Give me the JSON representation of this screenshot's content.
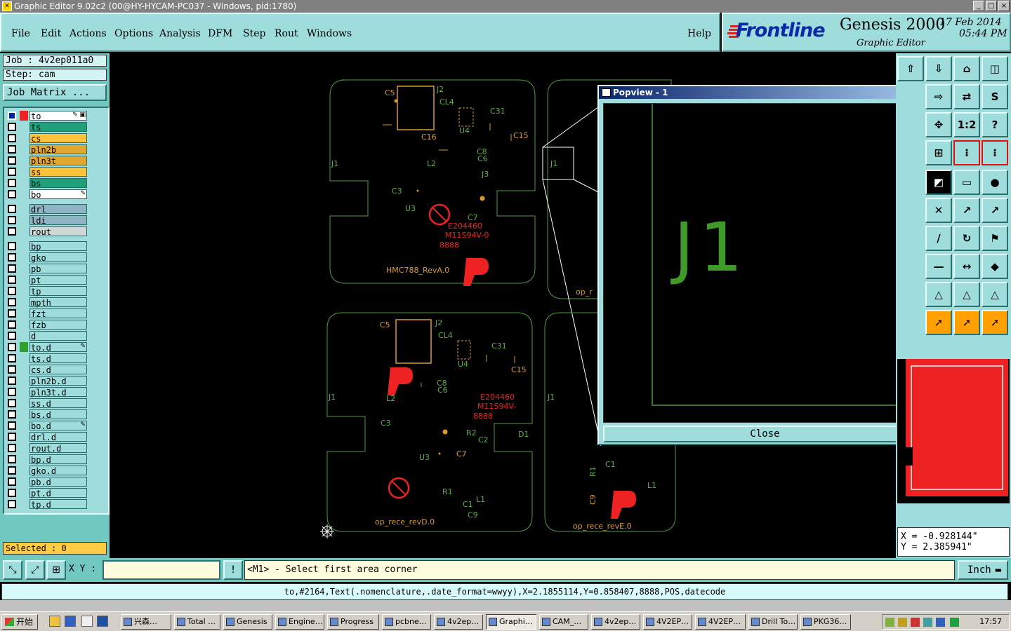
{
  "window": {
    "title": "Graphic Editor 9.02c2 (00@HY-HYCAM-PC037 - Windows, pid:1780)",
    "buttons": [
      "_",
      "□",
      "×"
    ]
  },
  "menu": {
    "items": [
      "File",
      "Edit",
      "Actions",
      "Options",
      "Analysis",
      "DFM",
      "Step",
      "Rout",
      "Windows"
    ],
    "help": "Help"
  },
  "brand": {
    "logo": "Frontline",
    "product": "Genesis 2000",
    "subtitle": "Graphic Editor",
    "date": "17 Feb 2014",
    "time": "05:44 PM"
  },
  "job": {
    "job_line": "Job : 4v2ep011a0",
    "step_line": "Step: cam",
    "matrix_button": "Job Matrix ..."
  },
  "layers": [
    {
      "name": "to",
      "color": "#ffffff",
      "swatch": "#ee2222",
      "flag": "✎ ▣",
      "state": "affected"
    },
    {
      "name": "ts",
      "color": "#1fa07a"
    },
    {
      "name": "cs",
      "color": "#ffc23a"
    },
    {
      "name": "pln2b",
      "color": "#e0a830"
    },
    {
      "name": "pln3t",
      "color": "#e0a830"
    },
    {
      "name": "ss",
      "color": "#ffc23a"
    },
    {
      "name": "bs",
      "color": "#1fa07a"
    },
    {
      "name": "bo",
      "color": "#ffffff",
      "flag": "✎"
    },
    {
      "name": "drl",
      "color": "#8fb4c4"
    },
    {
      "name": "ldi",
      "color": "#8fb4c4"
    },
    {
      "name": "rout",
      "color": "#d0d8d8"
    },
    {
      "name": "bp",
      "color": "#9fdcdc"
    },
    {
      "name": "gko",
      "color": "#9fdcdc"
    },
    {
      "name": "pb",
      "color": "#9fdcdc"
    },
    {
      "name": "pt",
      "color": "#9fdcdc"
    },
    {
      "name": "tp",
      "color": "#9fdcdc"
    },
    {
      "name": "mpth",
      "color": "#9fdcdc"
    },
    {
      "name": "fzt",
      "color": "#9fdcdc"
    },
    {
      "name": "fzb",
      "color": "#9fdcdc"
    },
    {
      "name": "d",
      "color": "#9fdcdc"
    },
    {
      "name": "to.d",
      "color": "#9fdcdc",
      "swatch": "#2ea02e",
      "flag": "✎"
    },
    {
      "name": "ts.d",
      "color": "#9fdcdc"
    },
    {
      "name": "cs.d",
      "color": "#9fdcdc"
    },
    {
      "name": "pln2b.d",
      "color": "#9fdcdc"
    },
    {
      "name": "pln3t.d",
      "color": "#9fdcdc"
    },
    {
      "name": "ss.d",
      "color": "#9fdcdc"
    },
    {
      "name": "bs.d",
      "color": "#9fdcdc"
    },
    {
      "name": "bo.d",
      "color": "#9fdcdc",
      "flag": "✎"
    },
    {
      "name": "drl.d",
      "color": "#9fdcdc"
    },
    {
      "name": "rout.d",
      "color": "#9fdcdc"
    },
    {
      "name": "bp.d",
      "color": "#9fdcdc"
    },
    {
      "name": "gko.d",
      "color": "#9fdcdc"
    },
    {
      "name": "pb.d",
      "color": "#9fdcdc"
    },
    {
      "name": "pt.d",
      "color": "#9fdcdc"
    },
    {
      "name": "tp.d",
      "color": "#9fdcdc"
    }
  ],
  "selected": "Selected : 0",
  "canvas": {
    "labels_board1": [
      "C5",
      "J2",
      "CL4",
      "C31",
      "C16",
      "U4",
      "C15",
      "C8",
      "C6",
      "J1",
      "L2",
      "J3",
      "C3",
      "U3",
      "C7",
      "E204460",
      "M11S94V-0",
      "8888",
      "HMC788_RevA.0"
    ],
    "labels_board2": [
      "J1",
      "op_r"
    ],
    "labels_board3": [
      "C5",
      "J2",
      "CL4",
      "C31",
      "U4",
      "C15",
      "C8",
      "C6",
      "L2",
      "J1",
      "E204460",
      "M11S94V-",
      "8888",
      "C3",
      "R2",
      "C2",
      "D1",
      "U3",
      "C7",
      "R1",
      "C1",
      "L1",
      "C9",
      "op_rece_revD.0"
    ],
    "labels_board4": [
      "J1",
      "C1",
      "R1",
      "L1",
      "C9",
      "op_rece_revE.0"
    ]
  },
  "popview": {
    "title": "Popview - 1",
    "zoom_text": "J1",
    "close_label": "Close"
  },
  "coords": {
    "x": "X = -0.928144\"",
    "y": "Y = 2.385941\""
  },
  "command": {
    "xy_label": "X Y :",
    "xy_value": "",
    "prompt": "<M1> - Select first area corner",
    "unit": "Inch"
  },
  "info_line": "to,#2164,Text(.nomenclature,.date_format=wwyy),X=2.1855114,Y=0.858407,8888,POS,datecode",
  "taskbar": {
    "start": "开始",
    "tasks": [
      "兴森…",
      "Total …",
      "Genesis",
      "Engine…",
      "Progress",
      "pcbne…",
      "4v2ep…",
      "Graphi…",
      "CAM_…",
      "4v2ep…",
      "4V2EP…",
      "4V2EP…",
      "Drill To…",
      "PKG36…"
    ],
    "active_task": "Graphi…",
    "clock": "17:57"
  }
}
